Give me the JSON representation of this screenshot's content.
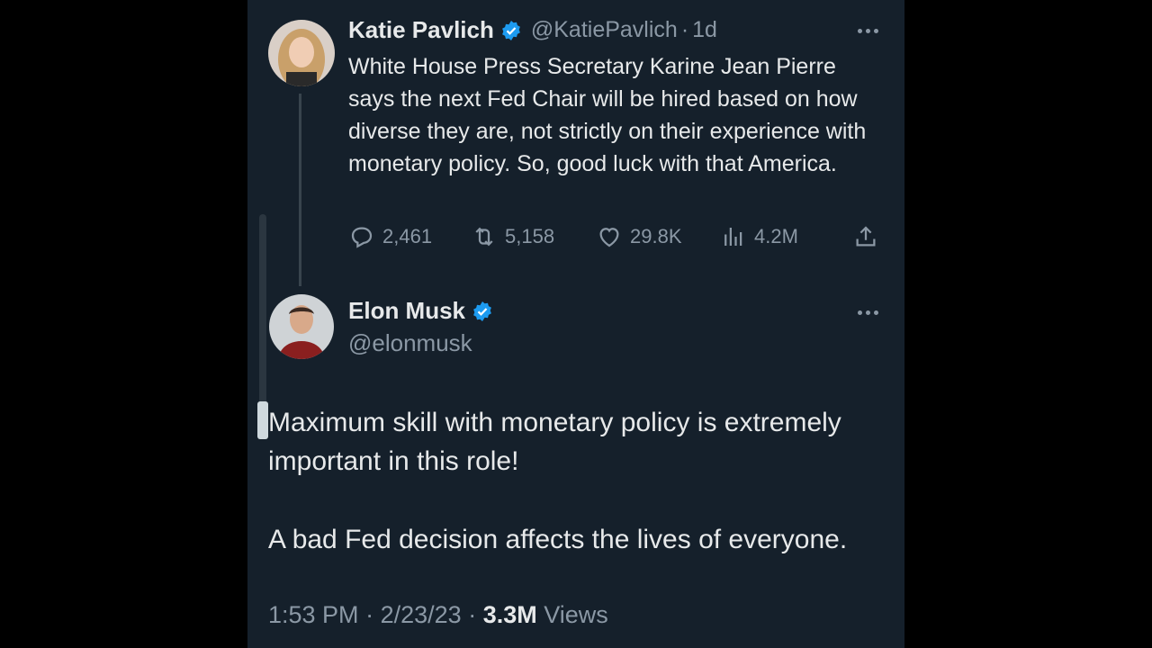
{
  "quoted_tweet": {
    "author_name": "Katie Pavlich",
    "handle": "@KatiePavlich",
    "age": "1d",
    "text": "White House Press Secretary Karine Jean Pierre says the next Fed Chair will be hired based on how diverse they are, not strictly on their experience with monetary policy. So, good luck with that America.",
    "stats": {
      "replies": "2,461",
      "retweets": "5,158",
      "likes": "29.8K",
      "views": "4.2M"
    }
  },
  "reply_tweet": {
    "author_name": "Elon Musk",
    "handle": "@elonmusk",
    "text_line1": "Maximum skill with monetary policy is extremely important in this role!",
    "text_line2": "A bad Fed decision affects the lives of everyone.",
    "time": "1:53 PM",
    "date": "2/23/23",
    "views_count": "3.3M",
    "views_label": "Views"
  },
  "colors": {
    "background": "#15202b",
    "verified": "#1d9bf0",
    "muted": "#8b98a5",
    "text": "#e7e9ea"
  },
  "icons": [
    "verified-badge-icon",
    "more-icon",
    "reply-icon",
    "retweet-icon",
    "like-icon",
    "views-icon",
    "share-icon"
  ]
}
